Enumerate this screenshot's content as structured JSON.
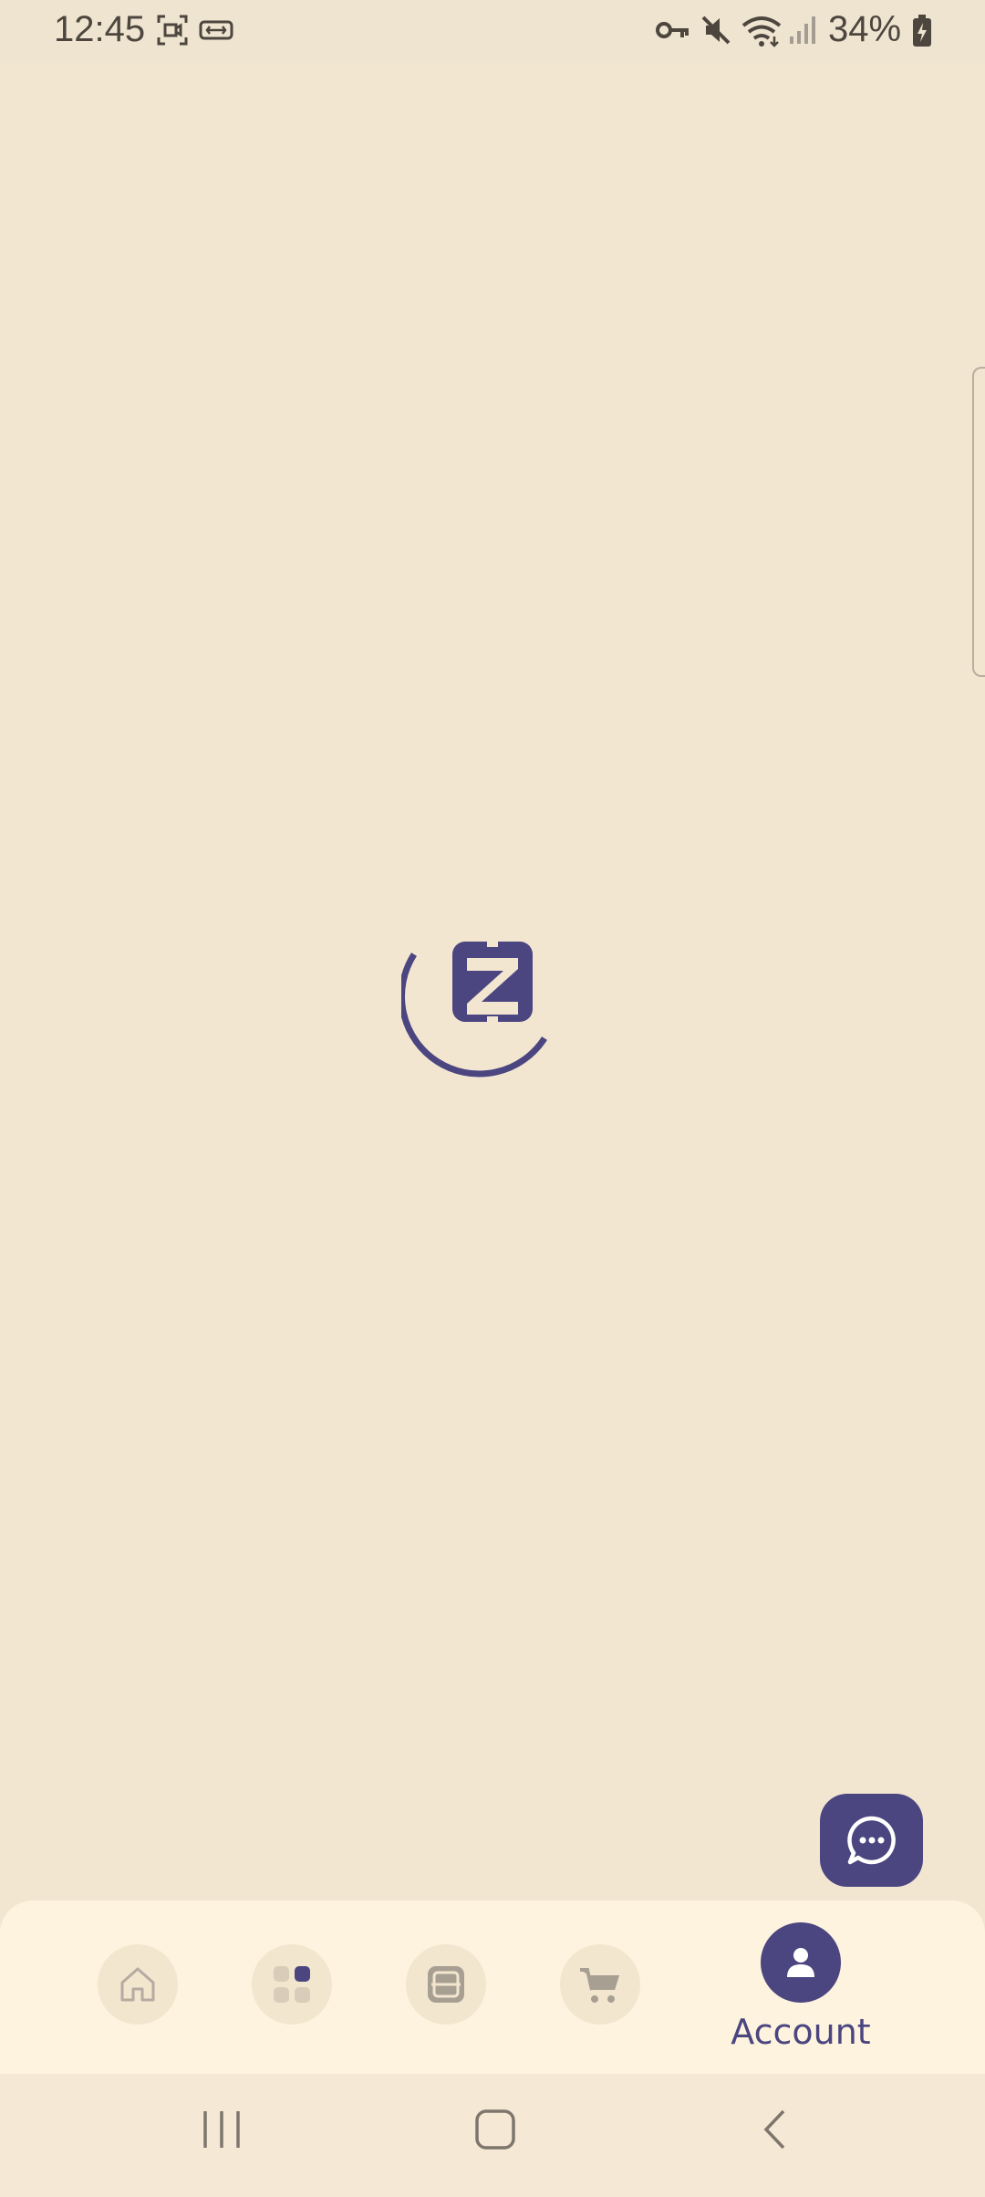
{
  "status_bar": {
    "time": "12:45",
    "battery_percent": "34%",
    "icons": [
      "screen-record-icon",
      "link-icon",
      "vpn-key-icon",
      "mute-icon",
      "wifi-icon",
      "signal-icon",
      "battery-charging-icon"
    ]
  },
  "loader": {
    "icon": "z-logo-spinner-icon",
    "logo_letter": "Z"
  },
  "chat_fab": {
    "icon": "chat-bubble-icon"
  },
  "bottom_nav": {
    "items": [
      {
        "icon": "home-icon",
        "active": false
      },
      {
        "icon": "categories-icon",
        "active": false
      },
      {
        "icon": "scan-icon",
        "active": false
      },
      {
        "icon": "cart-icon",
        "active": false
      },
      {
        "icon": "account-icon",
        "label": "Account",
        "active": true
      }
    ]
  },
  "system_nav": {
    "items": [
      "recent-apps-icon",
      "home-button-icon",
      "back-icon"
    ]
  },
  "colors": {
    "background": "#F2E6D1",
    "accent": "#4B4580",
    "nav_background": "#FDF3DF"
  }
}
